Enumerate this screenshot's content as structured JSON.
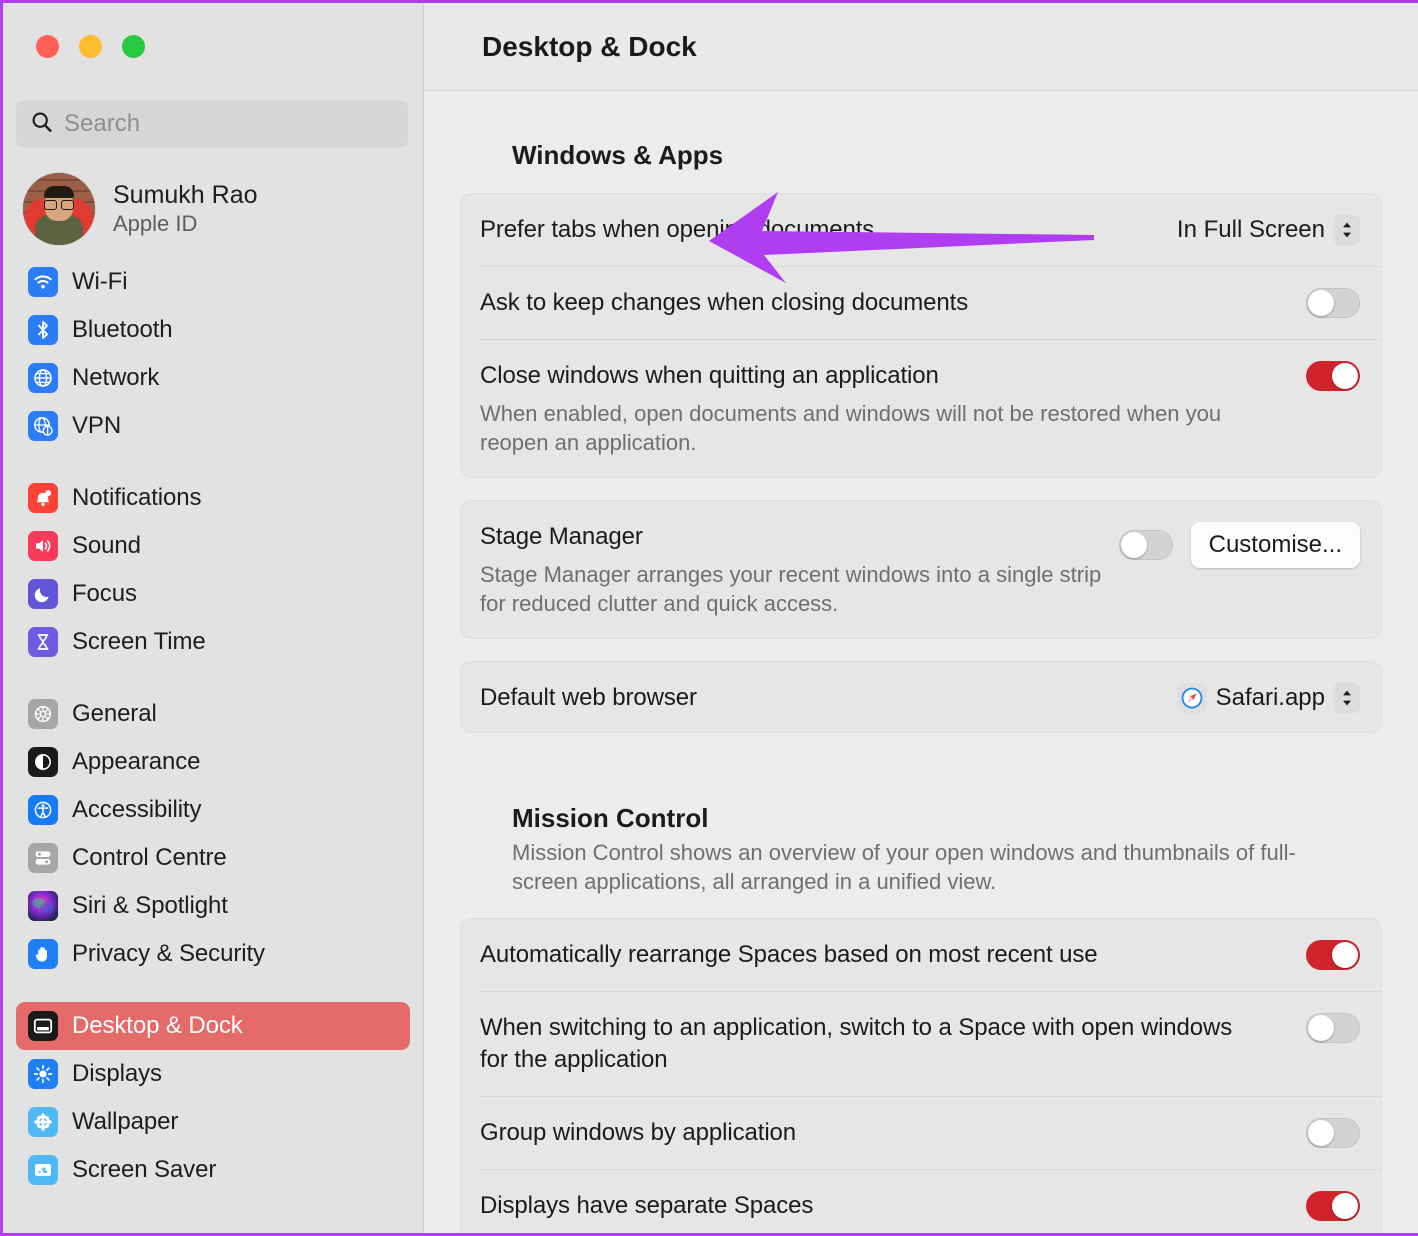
{
  "window": {
    "traffic_lights": [
      "close",
      "minimise",
      "zoom"
    ],
    "accent_color": "#d0232b",
    "selection_color": "#e56a6a",
    "annotation_color": "#b03ef0"
  },
  "sidebar": {
    "search": {
      "placeholder": "Search",
      "value": "",
      "icon": "search-icon"
    },
    "account": {
      "name": "Sumukh Rao",
      "subtitle": "Apple ID",
      "avatar": "user-avatar"
    },
    "groups": [
      {
        "items": [
          {
            "label": "Wi-Fi",
            "icon": "wifi-icon",
            "color": "#2b7cf6",
            "selected": false
          },
          {
            "label": "Bluetooth",
            "icon": "bluetooth-icon",
            "color": "#2b7cf6",
            "selected": false
          },
          {
            "label": "Network",
            "icon": "globe-icon",
            "color": "#2b7cf6",
            "selected": false
          },
          {
            "label": "VPN",
            "icon": "vpn-globe-icon",
            "color": "#2b7cf6",
            "selected": false
          }
        ]
      },
      {
        "items": [
          {
            "label": "Notifications",
            "icon": "bell-icon",
            "color": "#fa4236",
            "selected": false
          },
          {
            "label": "Sound",
            "icon": "speaker-icon",
            "color": "#f63a5a",
            "selected": false
          },
          {
            "label": "Focus",
            "icon": "moon-icon",
            "color": "#6255d6",
            "selected": false
          },
          {
            "label": "Screen Time",
            "icon": "hourglass-icon",
            "color": "#6e5ce0",
            "selected": false
          }
        ]
      },
      {
        "items": [
          {
            "label": "General",
            "icon": "gear-icon",
            "color": "#a6a6a6",
            "selected": false
          },
          {
            "label": "Appearance",
            "icon": "appearance-icon",
            "color": "#1a1a1a",
            "selected": false
          },
          {
            "label": "Accessibility",
            "icon": "accessibility-icon",
            "color": "#187bf6",
            "selected": false
          },
          {
            "label": "Control Centre",
            "icon": "control-centre-icon",
            "color": "#a6a6a6",
            "selected": false
          },
          {
            "label": "Siri & Spotlight",
            "icon": "siri-icon",
            "color": "#2a1f3d",
            "selected": false
          },
          {
            "label": "Privacy & Security",
            "icon": "hand-icon",
            "color": "#1f7ff5",
            "selected": false
          }
        ]
      },
      {
        "items": [
          {
            "label": "Desktop & Dock",
            "icon": "desktop-dock-icon",
            "color": "#1a1a1a",
            "selected": true
          },
          {
            "label": "Displays",
            "icon": "brightness-icon",
            "color": "#1f7ff5",
            "selected": false
          },
          {
            "label": "Wallpaper",
            "icon": "wallpaper-icon",
            "color": "#4fb9f5",
            "selected": false
          },
          {
            "label": "Screen Saver",
            "icon": "screen-saver-icon",
            "color": "#4fb9f5",
            "selected": false
          }
        ]
      }
    ]
  },
  "main": {
    "title": "Desktop & Dock",
    "sections": [
      {
        "heading": "Windows & Apps",
        "cards": [
          {
            "rows": [
              {
                "label": "Prefer tabs when opening documents",
                "desc": "",
                "control": "popup",
                "value": "In Full Screen"
              },
              {
                "label": "Ask to keep changes when closing documents",
                "desc": "",
                "control": "toggle",
                "value": "off"
              },
              {
                "label": "Close windows when quitting an application",
                "desc": "When enabled, open documents and windows will not be restored when you reopen an application.",
                "control": "toggle",
                "value": "on"
              }
            ]
          },
          {
            "rows": [
              {
                "label": "Stage Manager",
                "desc": "Stage Manager arranges your recent windows into a single strip for reduced clutter and quick access.",
                "control": "toggle-button",
                "value": "off",
                "button_label": "Customise..."
              }
            ]
          },
          {
            "rows": [
              {
                "label": "Default web browser",
                "desc": "",
                "control": "app-popup",
                "value": "Safari.app",
                "app_icon": "safari-icon"
              }
            ]
          }
        ]
      },
      {
        "heading": "Mission Control",
        "description": "Mission Control shows an overview of your open windows and thumbnails of full-screen applications, all arranged in a unified view.",
        "cards": [
          {
            "rows": [
              {
                "label": "Automatically rearrange Spaces based on most recent use",
                "desc": "",
                "control": "toggle",
                "value": "on"
              },
              {
                "label": "When switching to an application, switch to a Space with open windows for the application",
                "desc": "",
                "control": "toggle",
                "value": "off"
              },
              {
                "label": "Group windows by application",
                "desc": "",
                "control": "toggle",
                "value": "off"
              },
              {
                "label": "Displays have separate Spaces",
                "desc": "",
                "control": "toggle",
                "value": "on"
              }
            ]
          }
        ]
      }
    ]
  },
  "annotation": {
    "type": "arrow",
    "direction": "left",
    "points_at": "Windows & Apps",
    "color": "#b03ef0"
  }
}
